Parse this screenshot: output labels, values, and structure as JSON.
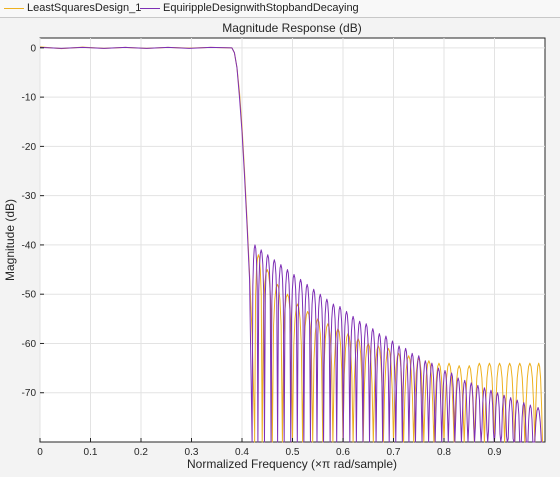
{
  "legend": {
    "items": [
      {
        "label": "LeastSquaresDesign_1",
        "color": "#edb120"
      },
      {
        "label": "EquirippleDesignwithStopbandDecaying",
        "color": "#7e2fb5"
      }
    ]
  },
  "chart_data": {
    "type": "line",
    "title": "Magnitude Response (dB)",
    "xlabel": "Normalized Frequency (×π rad/sample)",
    "ylabel": "Magnitude (dB)",
    "xlim": [
      0,
      1
    ],
    "ylim": [
      -80,
      2
    ],
    "xticks": [
      0,
      0.1,
      0.2,
      0.3,
      0.4,
      0.5,
      0.6,
      0.7,
      0.8,
      0.9
    ],
    "xtick_labels": [
      "0",
      "0.1",
      "0.2",
      "0.3",
      "0.4",
      "0.5",
      "0.6",
      "0.7",
      "0.8",
      "0.9"
    ],
    "yticks": [
      0,
      -10,
      -20,
      -30,
      -40,
      -50,
      -60,
      -70
    ],
    "ytick_labels": [
      "0",
      "-10",
      "-20",
      "-30",
      "-40",
      "-50",
      "-60",
      "-70"
    ],
    "grid": true,
    "legend_position": "top",
    "series": [
      {
        "name": "LeastSquaresDesign_1",
        "color": "#edb120",
        "passband": {
          "x": [
            0,
            0.38
          ],
          "ripple": [
            0.2,
            -0.15,
            0.15,
            -0.1,
            0.1,
            -0.1,
            0.1,
            -0.05,
            0.1,
            0
          ]
        },
        "transition": {
          "x": [
            0.38,
            0.385,
            0.39,
            0.395,
            0.4,
            0.405,
            0.41,
            0.415,
            0.42,
            0.425
          ],
          "y": [
            0,
            -1,
            -4,
            -9,
            -16,
            -25,
            -35,
            -46,
            -58,
            -78
          ]
        },
        "stopband": {
          "x_start": 0.425,
          "x_end": 0.995,
          "lobe_peaks_x": [
            0.43,
            0.45,
            0.47,
            0.49,
            0.51,
            0.53,
            0.55,
            0.57,
            0.59,
            0.61,
            0.63,
            0.65,
            0.67,
            0.69,
            0.71,
            0.73,
            0.75,
            0.77,
            0.79,
            0.81,
            0.83,
            0.85,
            0.87,
            0.89,
            0.91,
            0.93,
            0.95,
            0.97,
            0.99
          ],
          "lobe_peaks_db": [
            -42,
            -45,
            -48,
            -50,
            -52,
            -53.5,
            -55,
            -56,
            -57,
            -58,
            -59,
            -60,
            -60.5,
            -61,
            -62,
            -62.5,
            -63,
            -63.5,
            -64,
            -64,
            -64.5,
            -64.5,
            -64,
            -64,
            -64,
            -64,
            -64,
            -64,
            -64
          ]
        }
      },
      {
        "name": "EquirippleDesignwithStopbandDecaying",
        "color": "#7e2fb5",
        "passband": {
          "x": [
            0,
            0.38
          ],
          "ripple": [
            0.1,
            -0.1,
            0.1,
            -0.1,
            0.1,
            -0.1,
            0.1,
            -0.1,
            0.1,
            0
          ]
        },
        "transition": {
          "x": [
            0.38,
            0.385,
            0.39,
            0.395,
            0.4,
            0.405,
            0.41,
            0.415,
            0.42
          ],
          "y": [
            0,
            -1,
            -4,
            -10,
            -17,
            -26,
            -36,
            -47,
            -80
          ]
        },
        "stopband": {
          "x_start": 0.42,
          "x_end": 0.995,
          "lobe_peaks_x": [
            0.425,
            0.438,
            0.451,
            0.464,
            0.477,
            0.49,
            0.503,
            0.516,
            0.529,
            0.542,
            0.555,
            0.568,
            0.581,
            0.594,
            0.607,
            0.62,
            0.633,
            0.646,
            0.659,
            0.672,
            0.685,
            0.698,
            0.711,
            0.724,
            0.737,
            0.75,
            0.763,
            0.776,
            0.789,
            0.802,
            0.815,
            0.828,
            0.841,
            0.854,
            0.867,
            0.88,
            0.893,
            0.906,
            0.919,
            0.932,
            0.945,
            0.958,
            0.971,
            0.984
          ],
          "lobe_peaks_db": [
            -40,
            -41,
            -42,
            -43,
            -44,
            -45,
            -46,
            -47,
            -48,
            -49,
            -50,
            -51,
            -52,
            -52.5,
            -53.5,
            -54.5,
            -55.5,
            -56,
            -57,
            -58,
            -58.5,
            -59.5,
            -60.5,
            -61,
            -62,
            -62.5,
            -63.5,
            -64,
            -65,
            -65.5,
            -66,
            -67,
            -67.5,
            -68,
            -68.5,
            -69,
            -69.5,
            -70,
            -70.5,
            -71,
            -71.5,
            -72,
            -72.5,
            -73
          ]
        }
      }
    ]
  }
}
